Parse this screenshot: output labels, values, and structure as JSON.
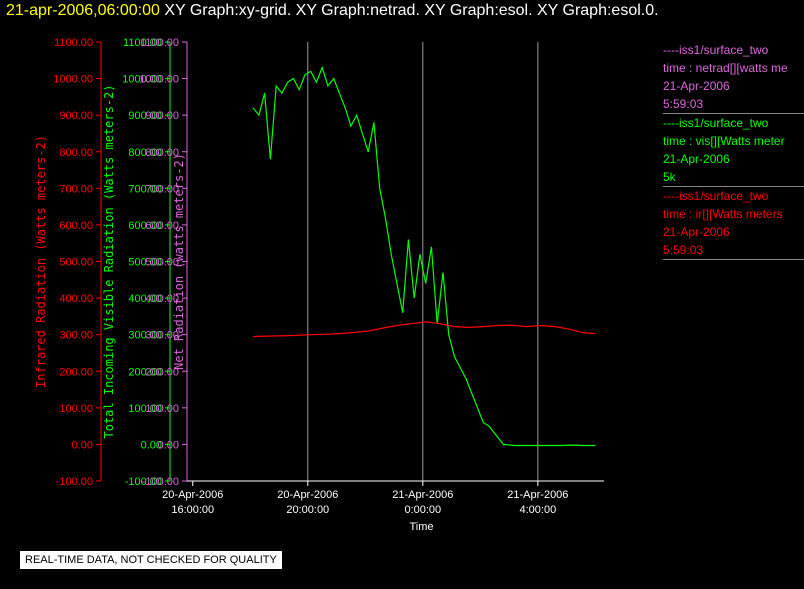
{
  "header": {
    "timestamp": "21-apr-2006,06:00:00",
    "titles": "XY Graph:xy-grid.  XY Graph:netrad.  XY Graph:esol.  XY Graph:esol.0."
  },
  "colors": {
    "ir": "#ff0000",
    "vis": "#00ff00",
    "net": "#dd66dd",
    "grid": "#9a9a9a",
    "axis": "#ffffff"
  },
  "legend": [
    {
      "series": "----iss1/surface_two",
      "var": "time : netrad[][watts me",
      "date": "21-Apr-2006",
      "time": "5:59:03",
      "color": "#dd66dd"
    },
    {
      "series": "----iss1/surface_two",
      "var": "time : vis[][Watts meter",
      "date": "21-Apr-2006",
      "time": "5k",
      "color": "#00ff00"
    },
    {
      "series": "----iss1/surface_two",
      "var": "time : ir[][Watts meters",
      "date": "21-Apr-2006",
      "time": "5:59:03",
      "color": "#ff0000"
    }
  ],
  "notice": "REAL-TIME DATA, NOT CHECKED FOR QUALITY",
  "chart_data": {
    "type": "line",
    "xlabel": "Time",
    "x_ticks": [
      {
        "d": "20-Apr-2006",
        "t": "16:00:00",
        "h": 16
      },
      {
        "d": "20-Apr-2006",
        "t": "20:00:00",
        "h": 20
      },
      {
        "d": "21-Apr-2006",
        "t": "0:00:00",
        "h": 24
      },
      {
        "d": "21-Apr-2006",
        "t": "4:00:00",
        "h": 28
      }
    ],
    "xlim": [
      15.8,
      30.3
    ],
    "grid_x": [
      20,
      24,
      28
    ],
    "y_ticks": [
      "1100.00",
      "1000.00",
      "900.00",
      "800.00",
      "700.00",
      "600.00",
      "500.00",
      "400.00",
      "300.00",
      "200.00",
      "100.00",
      "0.00",
      "-100.00"
    ],
    "y_axes": [
      {
        "label": "Infrared Radiation (Watts meters-2)",
        "color": "#ff0000",
        "ylim": [
          -100,
          1100
        ]
      },
      {
        "label": "Total Incoming Visible Radiation (Watts meters-2)",
        "color": "#00ff00",
        "ylim": [
          -100,
          1100
        ]
      },
      {
        "label": "Net Radiation (watts meters-2)",
        "color": "#dd66dd",
        "ylim": [
          -100,
          1100
        ]
      }
    ],
    "series": [
      {
        "name": "vis",
        "color": "#00ff00",
        "x": [
          18.1,
          18.3,
          18.5,
          18.7,
          18.9,
          19.1,
          19.3,
          19.5,
          19.7,
          19.9,
          20.1,
          20.3,
          20.5,
          20.7,
          20.9,
          21.1,
          21.3,
          21.5,
          21.7,
          21.9,
          22.1,
          22.3,
          22.5,
          22.7,
          22.9,
          23.1,
          23.3,
          23.5,
          23.7,
          23.9,
          24.1,
          24.3,
          24.5,
          24.7,
          24.9,
          25.1,
          25.3,
          25.5,
          25.7,
          25.9,
          26.1,
          26.3,
          26.5,
          26.8,
          27.2,
          27.6,
          28.0,
          28.4,
          28.8,
          29.2,
          29.6,
          30.0
        ],
        "y": [
          920,
          900,
          960,
          780,
          980,
          960,
          990,
          1000,
          970,
          1010,
          1020,
          990,
          1030,
          980,
          1000,
          960,
          920,
          870,
          900,
          850,
          800,
          880,
          700,
          620,
          520,
          440,
          360,
          560,
          400,
          520,
          440,
          540,
          330,
          470,
          300,
          240,
          210,
          180,
          140,
          100,
          60,
          50,
          30,
          0,
          -3,
          -3,
          -3,
          -3,
          -3,
          -2,
          -3,
          -3
        ]
      },
      {
        "name": "ir",
        "color": "#ff0000",
        "x": [
          18.1,
          18.6,
          19.1,
          19.6,
          20.1,
          20.6,
          21.1,
          21.6,
          22.1,
          22.6,
          23.1,
          23.6,
          24.1,
          24.6,
          25.1,
          25.6,
          26.1,
          26.6,
          27.1,
          27.6,
          28.1,
          28.6,
          29.1,
          29.6,
          30.0
        ],
        "y": [
          295,
          296,
          297,
          298,
          300,
          301,
          303,
          306,
          310,
          318,
          325,
          330,
          335,
          330,
          322,
          320,
          322,
          325,
          326,
          322,
          325,
          322,
          315,
          305,
          303
        ]
      }
    ]
  }
}
